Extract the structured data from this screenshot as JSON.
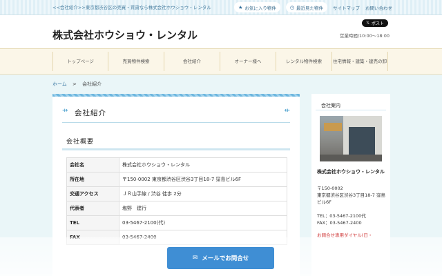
{
  "topbar": {
    "breadcrumb_text": "<<会社紹介>>東京都渋谷区の売買・賃貸なら株式会社ホウショウ・レンタル",
    "favorites_label": "お気に入り物件",
    "recent_label": "最近見た物件",
    "sitemap_label": "サイトマップ",
    "contact_label": "お問い合わせ"
  },
  "header": {
    "company_name": "株式会社ホウショウ・レンタル",
    "x_post_label": "ポスト",
    "hours": "営業時間/10:00～18:00"
  },
  "nav": {
    "items": [
      {
        "label": "トップページ"
      },
      {
        "label": "売買物件検索"
      },
      {
        "label": "会社紹介"
      },
      {
        "label": "オーナー様へ"
      },
      {
        "label": "レンタル物件検索"
      },
      {
        "label": "住宅情報・建築・建売の卸"
      }
    ]
  },
  "breadcrumb": {
    "home": "ホーム",
    "separator": ">",
    "current": "会社紹介"
  },
  "main": {
    "page_title": "会社紹介",
    "section_title": "会社概要",
    "rows": [
      {
        "key": "会社名",
        "value": "株式会社ホウショウ・レンタル"
      },
      {
        "key": "所在地",
        "value": "〒150-0002 東京都渋谷区渋谷3丁目18-7 窪島ビル6F"
      },
      {
        "key": "交通アクセス",
        "value": "ＪＲ山手線 / 渋谷 徒歩 2分"
      },
      {
        "key": "代表者",
        "value": "塩野　建行"
      },
      {
        "key": "TEL",
        "value": "03-5467-2100(代)"
      },
      {
        "key": "FAX",
        "value": "03-5467-2400"
      }
    ]
  },
  "side": {
    "head": "会社案内",
    "name": "株式会社ホウショウ・レンタル",
    "zip": "〒150-0002",
    "address": "東京都渋谷区渋谷3丁目18-7 窪島ビル6F",
    "tel": "TEL：03-5467-2100代",
    "fax": "FAX：03-5467-2400",
    "dial_label": "お問合せ専用ダイヤル(日・"
  },
  "cta": {
    "mail_label": "メールでお問合せ"
  },
  "colors": {
    "accent": "#3f8ed4",
    "nav_bg": "#fbf6e8",
    "page_bg": "#eaf6f8"
  }
}
